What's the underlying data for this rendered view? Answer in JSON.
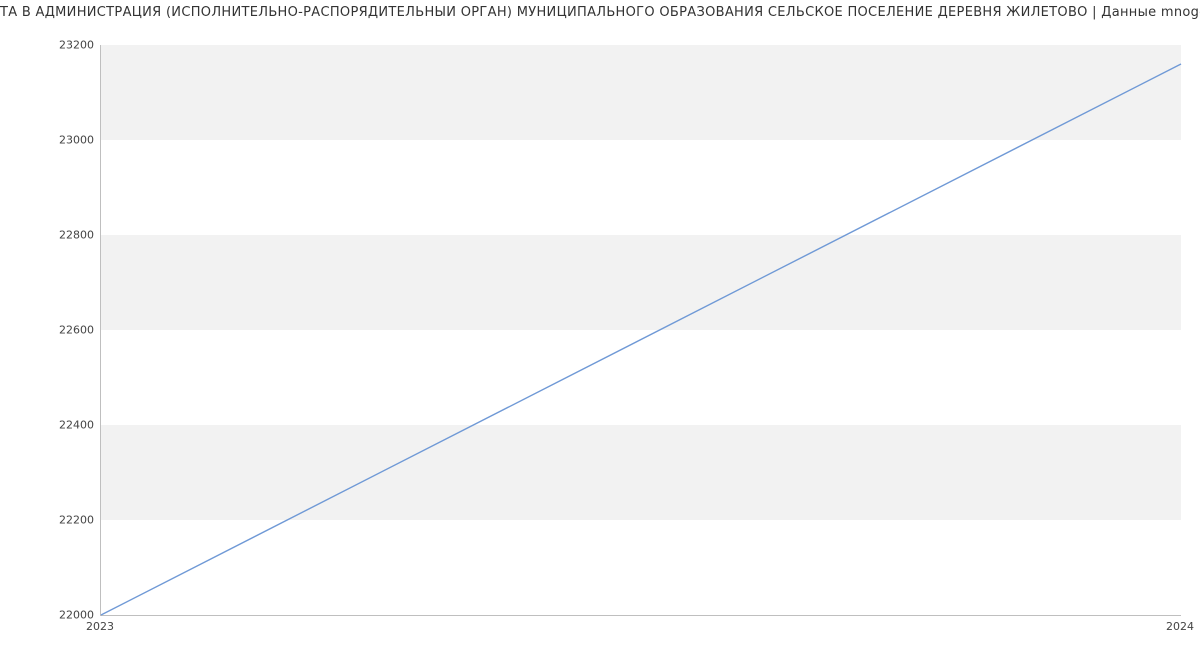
{
  "chart_data": {
    "type": "line",
    "title": "ТА В АДМИНИСТРАЦИЯ (ИСПОЛНИТЕЛЬНО-РАСПОРЯДИТЕЛЬНЫЙ ОРГАН) МУНИЦИПАЛЬНОГО ОБРАЗОВАНИЯ СЕЛЬСКОЕ ПОСЕЛЕНИЕ ДЕРЕВНЯ ЖИЛЕТОВО | Данные mnogodetey",
    "xlabel": "",
    "ylabel": "",
    "x": [
      2023,
      2024
    ],
    "series": [
      {
        "name": "",
        "values": [
          22000,
          23160
        ]
      }
    ],
    "x_ticks": [
      2023,
      2024
    ],
    "y_ticks": [
      22000,
      22200,
      22400,
      22600,
      22800,
      23000,
      23200
    ],
    "xlim": [
      2023,
      2024
    ],
    "ylim": [
      22000,
      23200
    ],
    "grid": true,
    "legend": false
  }
}
